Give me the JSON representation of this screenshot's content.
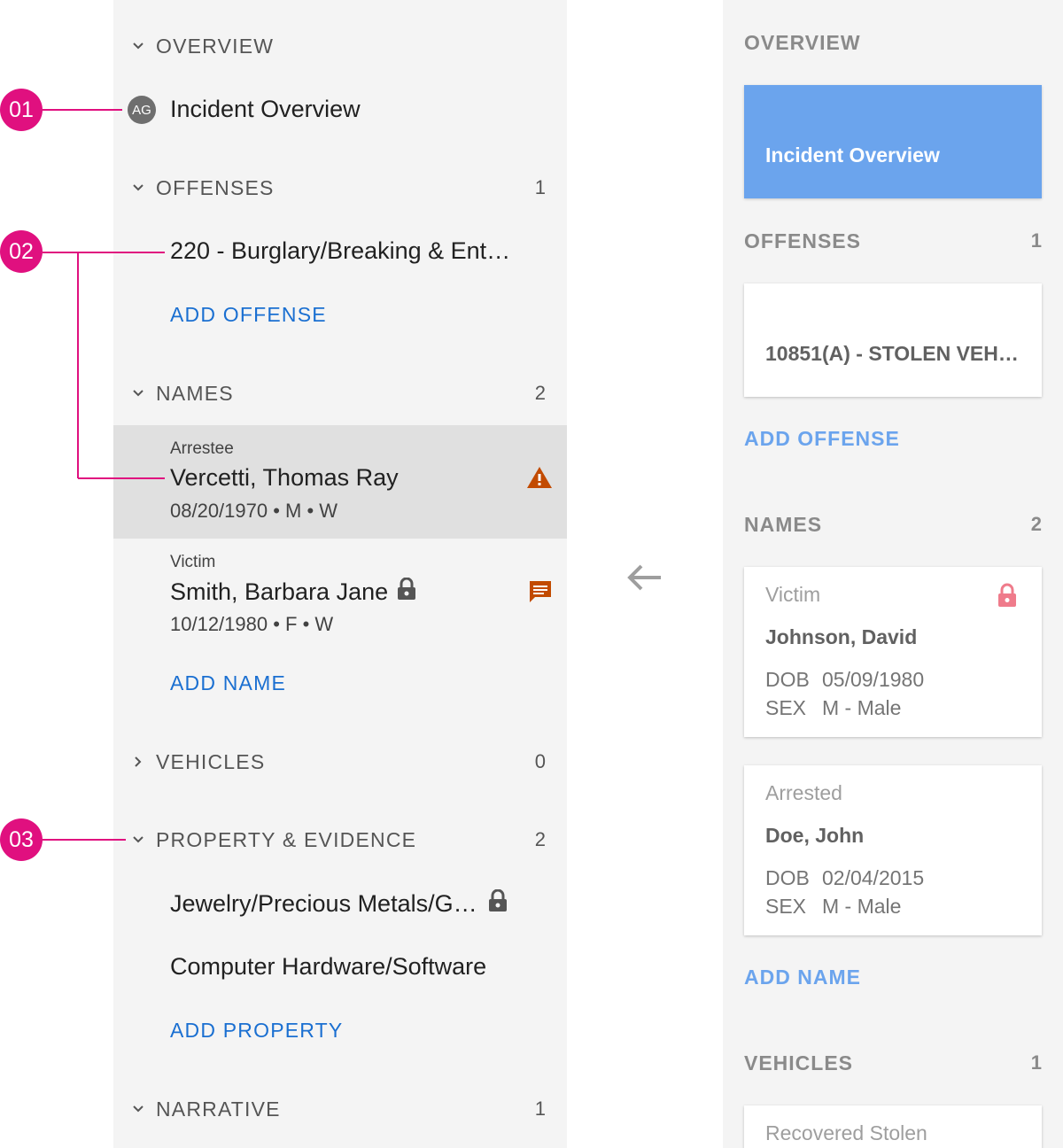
{
  "left": {
    "overview": {
      "title": "OVERVIEW",
      "item": "Incident Overview",
      "avatar": "AG"
    },
    "offenses": {
      "title": "OFFENSES",
      "count": "1",
      "items": [
        "220 - Burglary/Breaking & Ent…"
      ],
      "add": "ADD OFFENSE"
    },
    "names": {
      "title": "NAMES",
      "count": "2",
      "items": [
        {
          "role": "Arrestee",
          "name": "Vercetti, Thomas Ray",
          "meta": "08/20/1970 • M • W",
          "icon": "warning-icon"
        },
        {
          "role": "Victim",
          "name": "Smith, Barbara Jane",
          "meta": "10/12/1980 • F • W",
          "icon": "comment-icon"
        }
      ],
      "add": "ADD NAME"
    },
    "vehicles": {
      "title": "VEHICLES",
      "count": "0"
    },
    "property": {
      "title": "PROPERTY & EVIDENCE",
      "count": "2",
      "items": [
        "Jewelry/Precious Metals/G…",
        "Computer Hardware/Software"
      ],
      "add": "ADD PROPERTY"
    },
    "narrative": {
      "title": "NARRATIVE",
      "count": "1"
    }
  },
  "callouts": [
    "01",
    "02",
    "03"
  ],
  "right": {
    "overview": {
      "title": "OVERVIEW",
      "card": "Incident Overview"
    },
    "offenses": {
      "title": "OFFENSES",
      "count": "1",
      "card": "10851(A) - STOLEN VEH…",
      "add": "ADD OFFENSE"
    },
    "names": {
      "title": "NAMES",
      "count": "2",
      "cards": [
        {
          "role": "Victim",
          "name": "Johnson, David",
          "dob_label": "DOB",
          "dob": "05/09/1980",
          "sex_label": "SEX",
          "sex": "M - Male"
        },
        {
          "role": "Arrested",
          "name": "Doe, John",
          "dob_label": "DOB",
          "dob": "02/04/2015",
          "sex_label": "SEX",
          "sex": "M - Male"
        }
      ],
      "add": "ADD NAME"
    },
    "vehicles": {
      "title": "VEHICLES",
      "count": "1",
      "card_role": "Recovered Stolen"
    }
  },
  "colors": {
    "callout": "#e0107f",
    "link": "#1a6fd1",
    "warning": "#c24a00",
    "comment": "#c24a00",
    "right_active_card": "#6ba4ed",
    "right_lock": "#ef7b8b"
  }
}
